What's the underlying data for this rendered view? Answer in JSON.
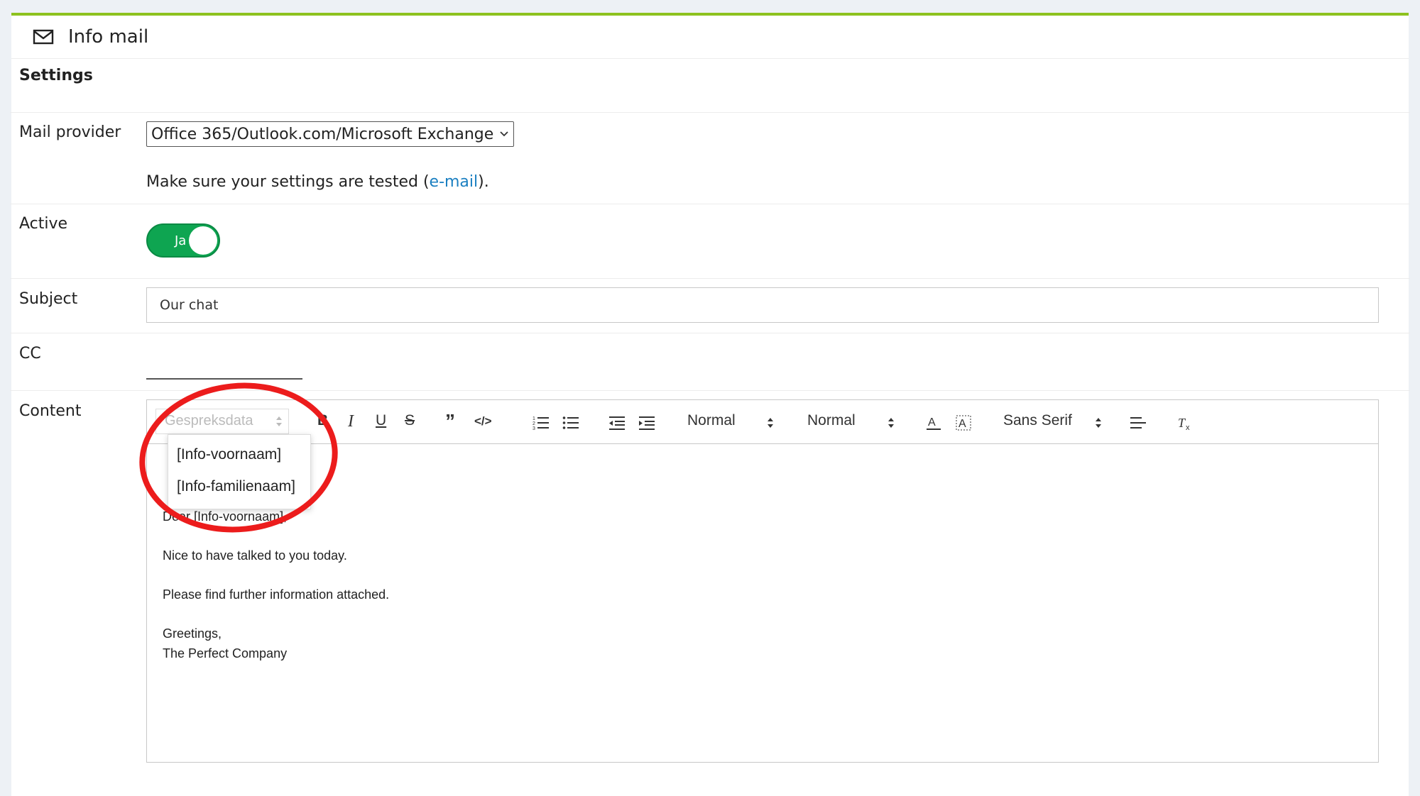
{
  "header": {
    "title": "Info mail",
    "icon": "mail-icon"
  },
  "settings": {
    "title": "Settings",
    "mail_provider": {
      "label": "Mail provider",
      "value": "Office 365/Outlook.com/Microsoft Exchange",
      "hint_prefix": "Make sure your settings are tested (",
      "hint_link": "e-mail",
      "hint_suffix": ")."
    },
    "active": {
      "label": "Active",
      "toggle_text": "Ja",
      "on": true,
      "color": "#0ea551"
    },
    "subject": {
      "label": "Subject",
      "value": "Our chat"
    },
    "cc": {
      "label": "CC",
      "value": ""
    },
    "content": {
      "label": "Content",
      "toolbar": {
        "placeholder_select": "Gespreksdata",
        "header_select": "Normal",
        "size_select": "Normal",
        "font_select": "Sans Serif",
        "dropdown_options": [
          "[Info-voornaam]",
          "[Info-familienaam]"
        ]
      },
      "body": {
        "line1": "Dear [Info-voornaam],",
        "line2": "Nice to have talked to you today.",
        "line3": "Please find further information attached.",
        "line4": "Greetings,",
        "line5": "The Perfect Company"
      }
    }
  },
  "colors": {
    "accent": "#8dc21f",
    "link": "#1a7fc1",
    "highlight_circle": "#ec1c1c"
  }
}
